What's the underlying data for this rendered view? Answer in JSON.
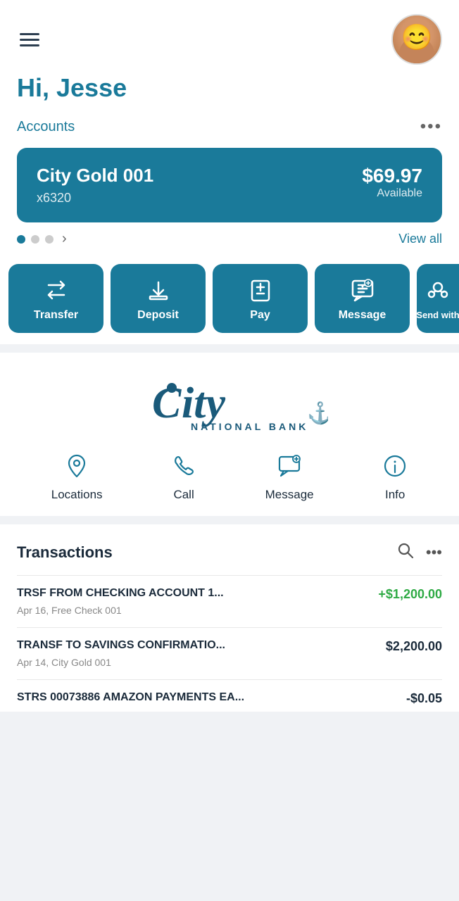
{
  "header": {
    "greeting": "Hi, Jesse",
    "menu_icon": "hamburger"
  },
  "accounts": {
    "label": "Accounts",
    "more_label": "•••",
    "card": {
      "name": "City Gold 001",
      "number": "x6320",
      "balance": "$69.97",
      "balance_label": "Available"
    },
    "dots": [
      true,
      false,
      false
    ],
    "view_all": "View all"
  },
  "actions": [
    {
      "id": "transfer",
      "label": "Transfer",
      "icon": "transfer"
    },
    {
      "id": "deposit",
      "label": "Deposit",
      "icon": "deposit"
    },
    {
      "id": "pay",
      "label": "Pay",
      "icon": "pay"
    },
    {
      "id": "message",
      "label": "Message",
      "icon": "message"
    },
    {
      "id": "send-with",
      "label": "Send with",
      "icon": "send-with"
    }
  ],
  "bank": {
    "name_large": "City",
    "name_sub": "NATIONAL BANK",
    "services": [
      {
        "id": "locations",
        "label": "Locations",
        "icon": "location-pin"
      },
      {
        "id": "call",
        "label": "Call",
        "icon": "phone"
      },
      {
        "id": "message",
        "label": "Message",
        "icon": "message-bubble"
      },
      {
        "id": "info",
        "label": "Info",
        "icon": "info-circle"
      }
    ]
  },
  "transactions": {
    "title": "Transactions",
    "items": [
      {
        "desc": "TRSF FROM CHECKING ACCOUNT 1...",
        "amount": "+$1,200.00",
        "amount_type": "positive",
        "date": "Apr 16",
        "account": "Free Check 001"
      },
      {
        "desc": "TRANSF TO SAVINGS CONFIRMATIO...",
        "amount": "$2,200.00",
        "amount_type": "neutral",
        "date": "Apr 14",
        "account": "City Gold 001"
      },
      {
        "desc": "STRS 00073886 AMAZON PAYMENTS EA...",
        "amount": "-$0.05",
        "amount_type": "partial",
        "date": "",
        "account": ""
      }
    ]
  }
}
